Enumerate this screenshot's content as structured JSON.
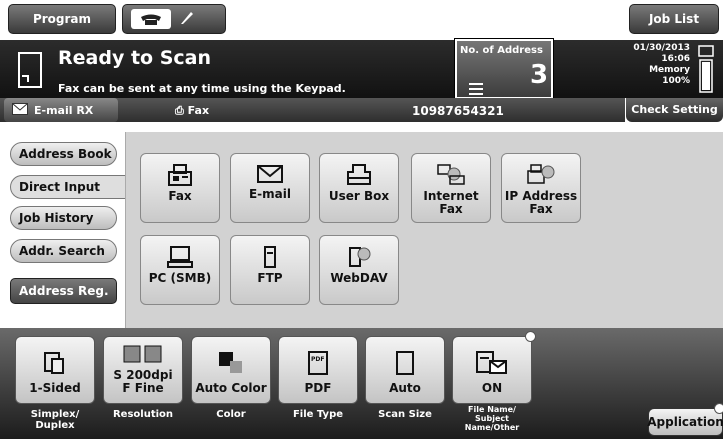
{
  "top": {
    "program_label": "Program",
    "job_list_label": "Job List"
  },
  "status": {
    "title": "Ready to Scan",
    "subtitle": "Fax can be sent at any time using the Keypad.",
    "address_label": "No. of Address",
    "address_count": "3",
    "date": "01/30/2013",
    "time": "16:06",
    "memory_label": "Memory",
    "memory_value": "100%",
    "check_setting": "Check Setting"
  },
  "line": {
    "email_rx": "E-mail RX",
    "fax_label": "Fax",
    "fax_number": "10987654321"
  },
  "nav": {
    "address_book": "Address Book",
    "direct_input": "Direct Input",
    "job_history": "Job History",
    "addr_search": "Addr. Search",
    "address_reg": "Address Reg."
  },
  "destinations": {
    "fax": "Fax",
    "email": "E-mail",
    "user_box": "User Box",
    "internet_fax": "Internet Fax",
    "ip_address_fax_1": "IP Address",
    "ip_address_fax_2": "Fax",
    "pc_smb": "PC (SMB)",
    "ftp": "FTP",
    "webdav": "WebDAV"
  },
  "settings": {
    "sided_value": "1-Sided",
    "sided_label_1": "Simplex/",
    "sided_label_2": "Duplex",
    "resolution_value_1": "S 200dpi",
    "resolution_value_2": "F Fine",
    "resolution_label": "Resolution",
    "color_value": "Auto Color",
    "color_label": "Color",
    "filetype_value": "PDF",
    "filetype_label": "File Type",
    "scansize_value": "Auto",
    "scansize_label": "Scan Size",
    "filename_value": "ON",
    "filename_label_1": "File Name/",
    "filename_label_2": "Subject",
    "filename_label_3": "Name/Other",
    "application": "Application"
  }
}
